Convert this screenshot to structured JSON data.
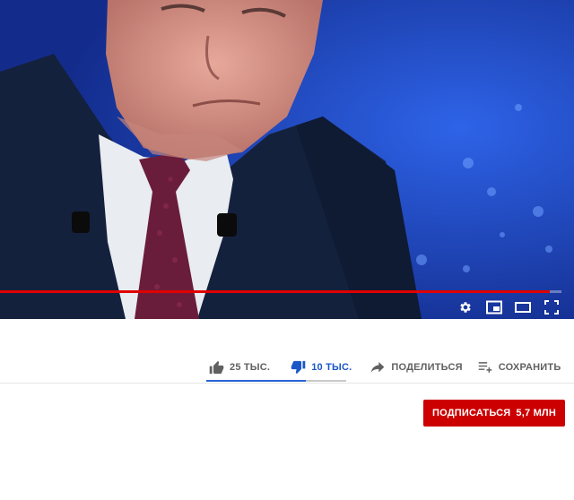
{
  "player": {
    "progress_percent": 98,
    "controls": [
      {
        "icon": "settings-gear-icon"
      },
      {
        "icon": "miniplayer-icon"
      },
      {
        "icon": "theater-mode-icon"
      },
      {
        "icon": "fullscreen-icon"
      }
    ]
  },
  "actions": {
    "like_count": "25 ТЫС.",
    "dislike_count": "10 ТЫС.",
    "share_label": "ПОДЕЛИТЬСЯ",
    "save_label": "СОХРАНИТЬ",
    "like_ratio_percent": 71
  },
  "channel": {
    "subscribe_label": "ПОДПИСАТЬСЯ",
    "subscriber_count": "5,7 МЛН"
  },
  "colors": {
    "accent_red": "#cc0000",
    "progress_red": "#e00000",
    "active_blue": "#1a56c8"
  }
}
